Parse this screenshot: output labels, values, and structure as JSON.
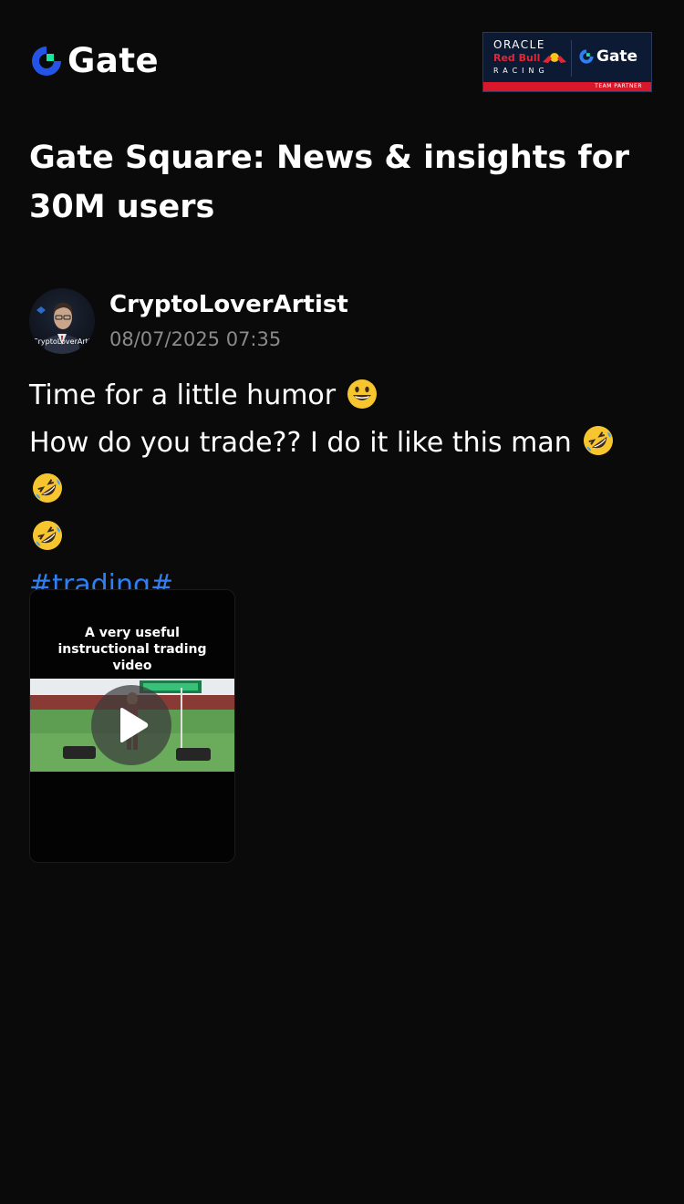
{
  "header": {
    "logo_text": "Gate",
    "partner": {
      "oracle": "ORACLE",
      "redbull": "Red Bull",
      "racing": "RACING",
      "gate_text": "Gate",
      "strip_text": "TEAM PARTNER"
    }
  },
  "page_title": "Gate Square: News & insights for 30M users",
  "post": {
    "avatar_label": "CryptoLoverArtist",
    "author": "CryptoLoverArtist",
    "timestamp": "08/07/2025 07:35",
    "line1": "Time for a little humor",
    "line2": "How do you trade?? I do it like this man",
    "hashtag": "#trading#",
    "video": {
      "caption": "A very useful instructional trading video",
      "icon": "play-icon"
    }
  },
  "colors": {
    "background": "#0a0a0a",
    "hashtag": "#2f7ff2",
    "brand_blue": "#2354e6",
    "brand_green": "#17e6a1",
    "timestamp": "#8a8a8a"
  }
}
